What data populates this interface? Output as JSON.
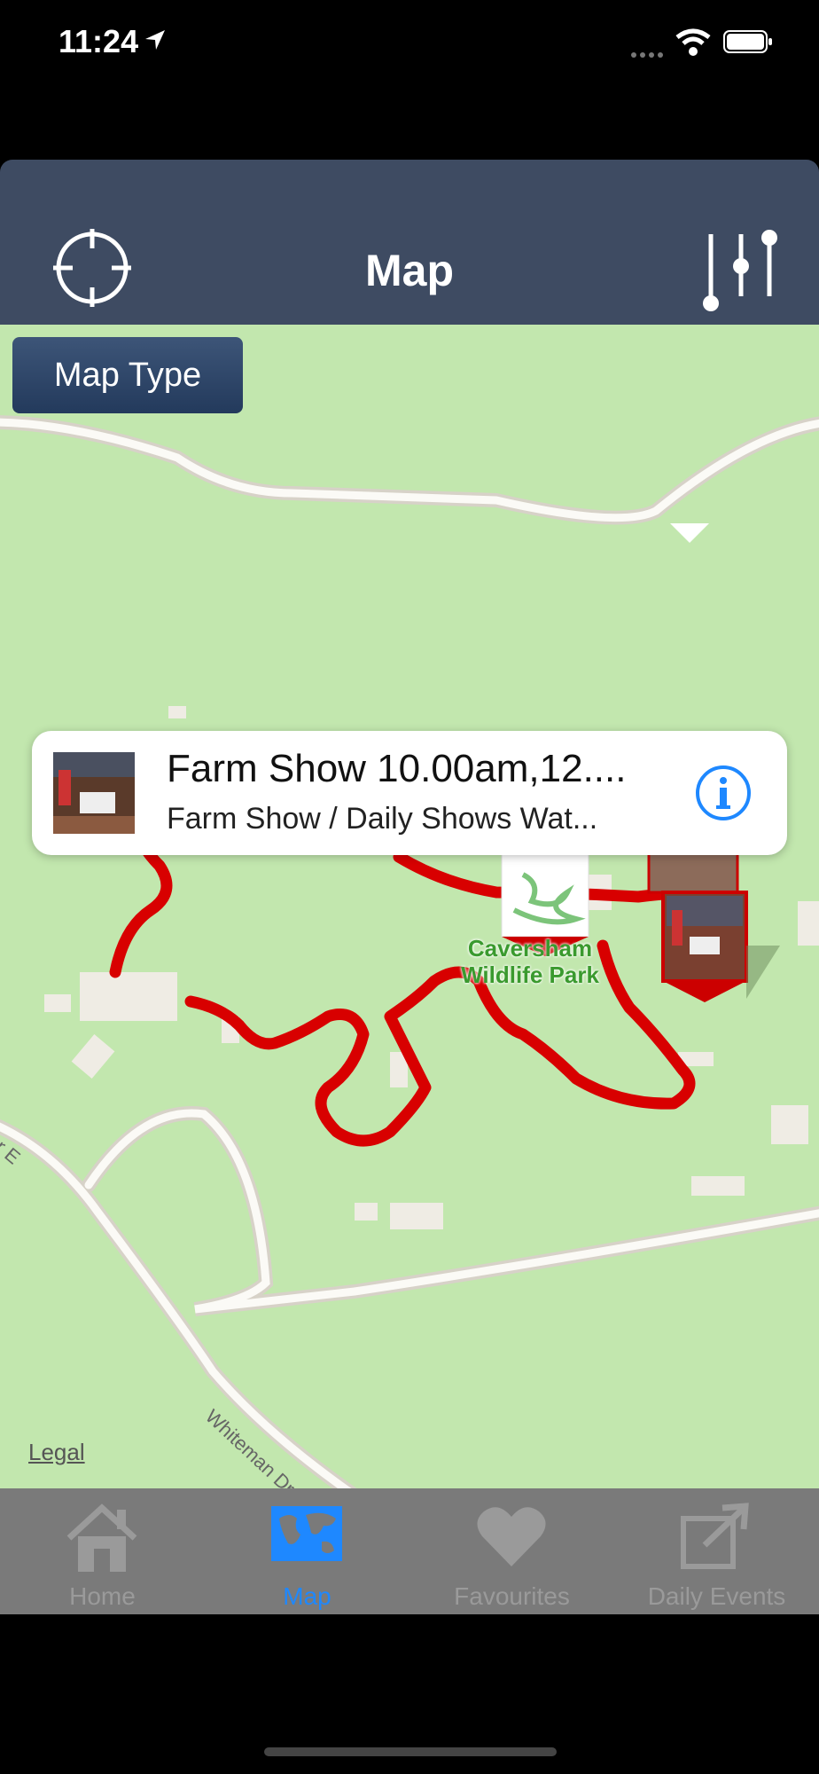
{
  "status": {
    "time": "11:24"
  },
  "nav": {
    "title": "Map"
  },
  "map": {
    "map_type_label": "Map Type",
    "legal_label": "Legal",
    "poi_label_line1": "Caversham",
    "poi_label_line2": "Wildlife Park",
    "road_label": "Whiteman Dr E",
    "road_label_short": "Dr E"
  },
  "callout": {
    "title": "Farm Show 10.00am,12....",
    "subtitle": "Farm Show / Daily Shows Wat..."
  },
  "tabs": [
    {
      "label": "Home",
      "icon": "home-icon",
      "active": false
    },
    {
      "label": "Map",
      "icon": "map-icon",
      "active": true
    },
    {
      "label": "Favourites",
      "icon": "heart-icon",
      "active": false
    },
    {
      "label": "Daily Events",
      "icon": "share-icon",
      "active": false
    }
  ],
  "colors": {
    "nav": "#3e4b62",
    "map": "#c2e7ae",
    "route": "#d80000",
    "active_tab": "#1e88ff"
  }
}
